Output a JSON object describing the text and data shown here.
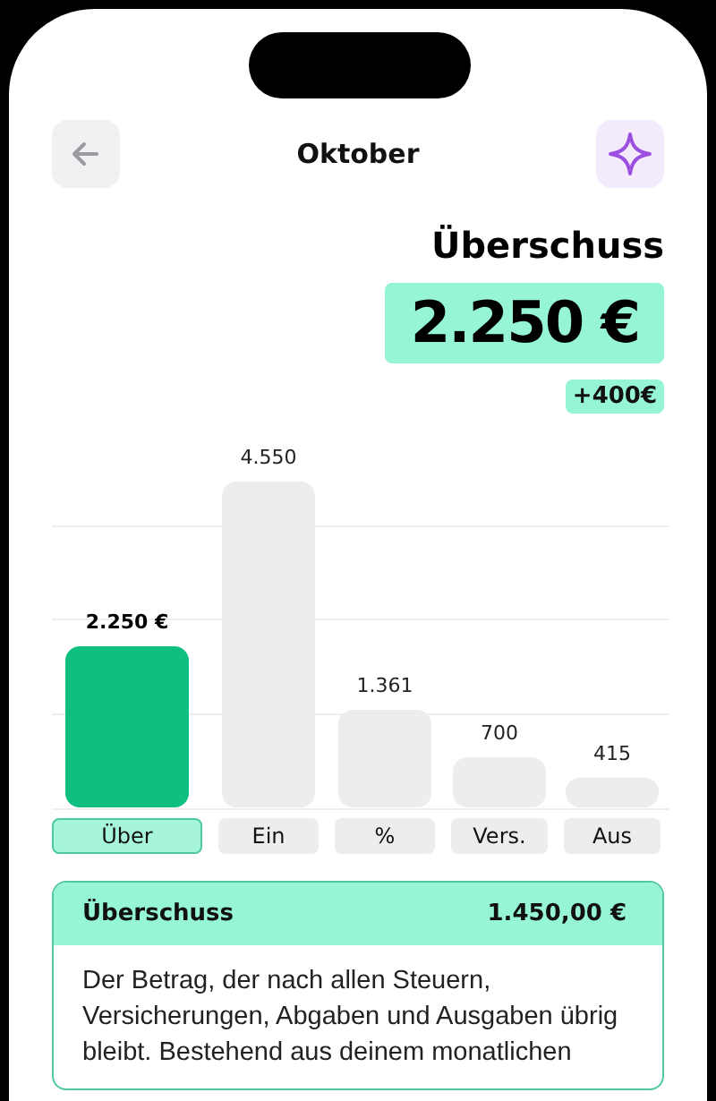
{
  "header": {
    "title": "Oktober"
  },
  "summary": {
    "heading": "Überschuss",
    "amount": "2.250 €",
    "change": "+400€"
  },
  "chart": {
    "chart_data": {
      "type": "bar",
      "categories": [
        "Über",
        "Ein",
        "%",
        "Vers.",
        "Aus"
      ],
      "values": [
        2250,
        4550,
        1361,
        700,
        415
      ],
      "data_labels": true,
      "value_labels": [
        "2.250 €",
        "4.550",
        "1.361",
        "700",
        "415"
      ]
    },
    "tabs": [
      {
        "selected": true
      },
      {
        "selected": false
      },
      {
        "selected": false
      },
      {
        "selected": false
      },
      {
        "selected": false
      }
    ]
  },
  "card": {
    "title": "Überschuss",
    "value": "1.450,00 €",
    "text": "Der Betrag, der nach allen Steuern, Versicherungen, Abgaben und Ausgaben übrig bleibt. Bestehend aus deinem monatlichen"
  }
}
